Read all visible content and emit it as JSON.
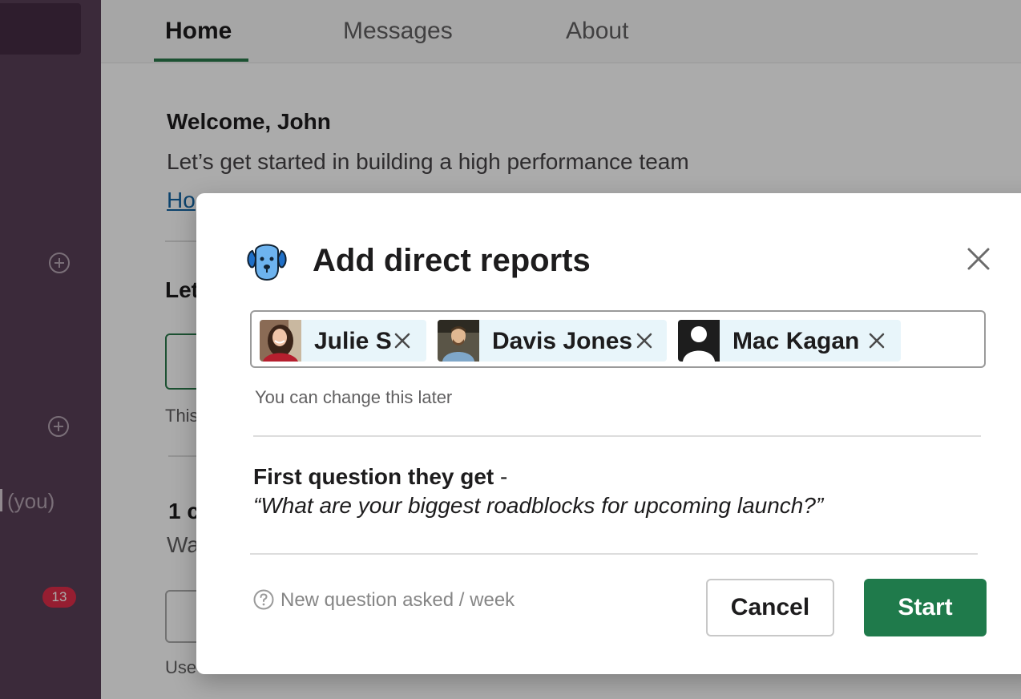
{
  "sidebar": {
    "you_label": "(you)",
    "badge_count": "13"
  },
  "tabs": [
    {
      "label": "Home",
      "active": true
    },
    {
      "label": "Messages",
      "active": false
    },
    {
      "label": "About",
      "active": false
    }
  ],
  "home": {
    "welcome": "Welcome, John",
    "subtitle": "Let’s get started in building a high performance team",
    "link_partial": "Ho",
    "section_partial": "Let",
    "this_partial": "This",
    "count_partial": "1 c",
    "wa_partial": "Wa",
    "use_partial": "Use"
  },
  "modal": {
    "title": "Add direct reports",
    "icon": "dog-icon",
    "selected_reports": [
      {
        "name": "Julie S",
        "avatar": "photo"
      },
      {
        "name": "Davis Jones",
        "avatar": "photo"
      },
      {
        "name": "Mac Kagan",
        "avatar": "default-user"
      }
    ],
    "hint": "You can change this later",
    "question_label": "First question they get",
    "question_separator": " -",
    "question_text": "“What are your biggest roadblocks for upcoming launch?”",
    "frequency": "New question asked / week",
    "cancel_label": "Cancel",
    "start_label": "Start"
  },
  "colors": {
    "sidebar": "#593f57",
    "accent": "#1f7a4b",
    "chip_bg": "#e8f5fa",
    "link": "#1264a3"
  }
}
